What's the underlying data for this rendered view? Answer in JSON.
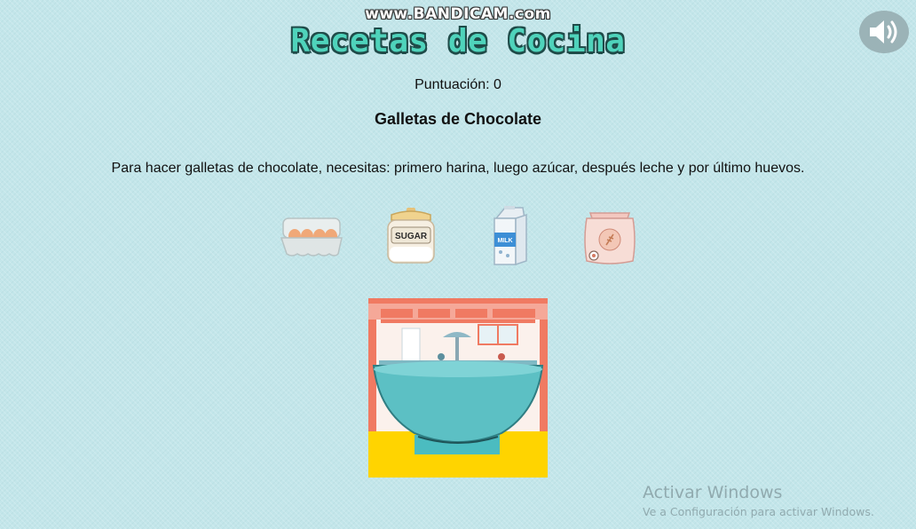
{
  "watermark": "www.BANDICAM.com",
  "title": "Recetas de Cocina",
  "sound_icon": "speaker-volume-icon",
  "score": {
    "label": "Puntuación: 0"
  },
  "recipe": {
    "title": "Galletas de Chocolate",
    "instructions": "Para hacer galletas de chocolate, necesitas: primero harina, luego azúcar, después leche y por último huevos."
  },
  "ingredients": [
    {
      "name": "eggs",
      "icon": "egg-carton-icon"
    },
    {
      "name": "sugar",
      "icon": "sugar-jar-icon",
      "jar_label": "SUGAR"
    },
    {
      "name": "milk",
      "icon": "milk-carton-icon",
      "carton_label": "MILK"
    },
    {
      "name": "flour",
      "icon": "flour-bag-icon"
    }
  ],
  "windows_activation": {
    "line1": "Activar Windows",
    "line2": "Ve a Configuración para activar Windows."
  },
  "colors": {
    "background": "#c3e6ea",
    "title_fill": "#4fd3bb",
    "title_outline": "#1f4b49",
    "bowl": "#5cc0c4",
    "kitchen_frame": "#f07a62",
    "floor": "#ffd400"
  }
}
